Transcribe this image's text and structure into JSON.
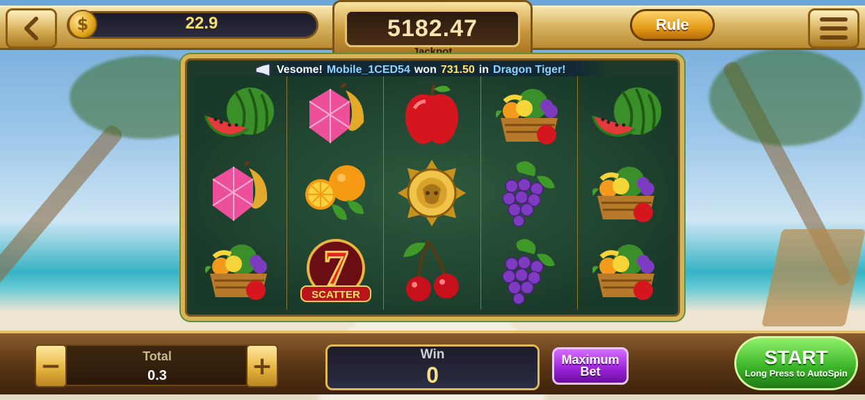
{
  "top_bar": {
    "back_icon": "chevron-left-icon",
    "coin_icon": "dollar-coin-icon",
    "coin_symbol": "$",
    "balance": "22.9",
    "jackpot_value": "5182.47",
    "jackpot_label": "Jackpot",
    "rule_label": "Rule",
    "menu_icon": "hamburger-menu-icon"
  },
  "ticker": {
    "icon": "megaphone-icon",
    "prefix": "Vesome!",
    "user": "Mobile_1CED54",
    "won": "won",
    "amount": "731.50",
    "in": "in",
    "game": "Dragon Tiger!"
  },
  "reels": [
    [
      "watermelon",
      "pink-diamond-peach",
      "apple",
      "fruit-basket",
      "watermelon"
    ],
    [
      "pink-diamond-peach",
      "orange",
      "gold-medallion",
      "grapes",
      "fruit-basket"
    ],
    [
      "fruit-basket",
      "scatter-7",
      "cherries",
      "grapes",
      "fruit-basket"
    ]
  ],
  "symbols": {
    "scatter_seven": "7",
    "scatter_text": "SCATTER"
  },
  "bottom_bar": {
    "minus_label": "−",
    "plus_label": "+",
    "total_label": "Total",
    "total_value": "0.3",
    "win_label": "Win",
    "win_value": "0",
    "max_bet_line1": "Maximum",
    "max_bet_line2": "Bet",
    "start_label": "START",
    "start_sub": "Long Press to AutoSpin"
  },
  "colors": {
    "gold": "#d9b25a",
    "start_green": "#3fb82c",
    "max_bet_purple": "#9a22d6",
    "reel_bg": "#1a3a29",
    "ticker_user": "#8fd3ff",
    "ticker_amount": "#ffe36a"
  }
}
